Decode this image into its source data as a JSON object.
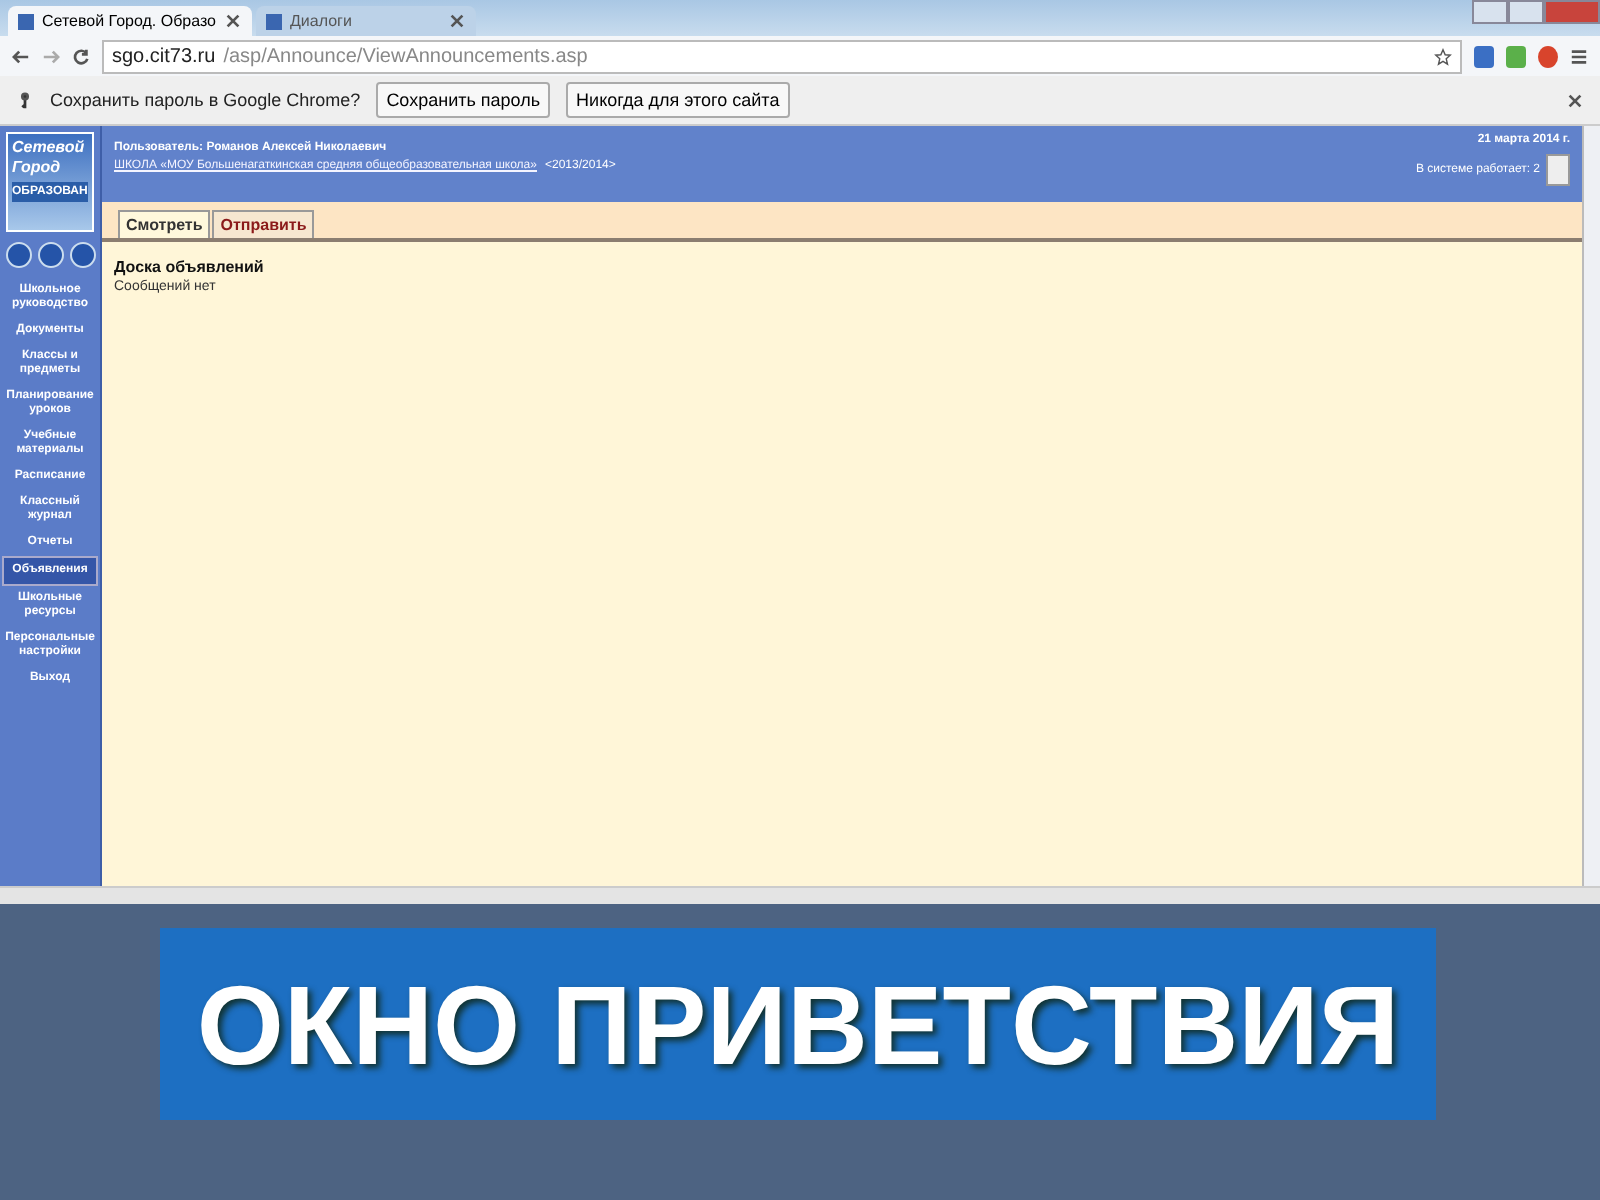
{
  "browser": {
    "tabs": [
      {
        "title": "Сетевой Город. Образо",
        "selected": true
      },
      {
        "title": "Диалоги",
        "selected": false
      }
    ],
    "address": {
      "host": "sgo.cit73.ru",
      "path": "/asp/Announce/ViewAnnouncements.asp"
    },
    "infobar": {
      "message": "Сохранить пароль в Google Chrome?",
      "buttons": [
        "Сохранить пароль",
        "Никогда для этого сайта"
      ]
    }
  },
  "logo": {
    "lines": [
      "Сетевой",
      "Город",
      "ОБРАЗОВАН"
    ]
  },
  "sidebar": {
    "items": [
      {
        "label": "Школьное руководство",
        "selected": false
      },
      {
        "label": "Документы",
        "selected": false
      },
      {
        "label": "Классы и предметы",
        "selected": false
      },
      {
        "label": "Планирование уроков",
        "selected": false
      },
      {
        "label": "Учебные материалы",
        "selected": false
      },
      {
        "label": "Расписание",
        "selected": false
      },
      {
        "label": "Классный журнал",
        "selected": false
      },
      {
        "label": "Отчеты",
        "selected": false
      },
      {
        "label": "Объявления",
        "selected": true
      },
      {
        "label": "Школьные ресурсы",
        "selected": false
      },
      {
        "label": "Персональные настройки",
        "selected": false
      },
      {
        "label": "Выход",
        "selected": false
      }
    ]
  },
  "header": {
    "user": "Пользователь: Романов Алексей Николаевич",
    "school": "ШКОЛА «МОУ Большенагаткинская средняя общеобразовательная школа»",
    "year": "<2013/2014>",
    "date": "21 марта 2014 г.",
    "online": "В системе работает: 2"
  },
  "page_tabs": [
    {
      "label": "Смотреть",
      "selected": true
    },
    {
      "label": "Отправить",
      "selected": false
    }
  ],
  "content": {
    "title": "Доска объявлений",
    "message": "Сообщений нет"
  },
  "slide_title": "ОКНО ПРИВЕТСТВИЯ"
}
